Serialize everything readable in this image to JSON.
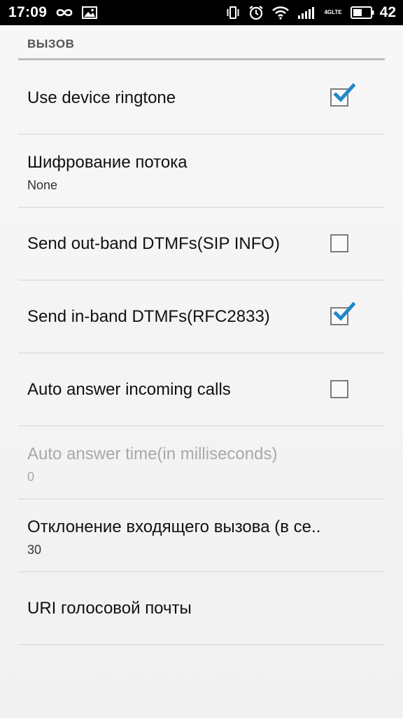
{
  "status_bar": {
    "time": "17:09",
    "network_top": "4G",
    "network_bottom": "LTE",
    "battery_level": "42",
    "icons": [
      "infinity-icon",
      "gallery-icon",
      "vibrate-icon",
      "alarm-icon",
      "wifi-icon",
      "signal-icon",
      "battery-icon"
    ]
  },
  "section": {
    "title": "ВЫЗОВ"
  },
  "preferences": [
    {
      "title": "Use device ringtone",
      "checkbox": true,
      "checked": true
    },
    {
      "title": "Шифрование потока",
      "summary": "None"
    },
    {
      "title": "Send out-band DTMFs(SIP INFO)",
      "checkbox": true,
      "checked": false
    },
    {
      "title": "Send in-band DTMFs(RFC2833)",
      "checkbox": true,
      "checked": true
    },
    {
      "title": "Auto answer incoming calls",
      "checkbox": true,
      "checked": false
    },
    {
      "title": "Auto answer time(in milliseconds)",
      "summary": "0",
      "enabled": false
    },
    {
      "title": "Отклонение входящего вызова (в се..",
      "summary": "30"
    },
    {
      "title": "URI голосовой почты"
    }
  ],
  "colors": {
    "accent": "#1e88c8",
    "check_border": "#7d7d7d",
    "disabled_text": "#a9a9a9"
  }
}
